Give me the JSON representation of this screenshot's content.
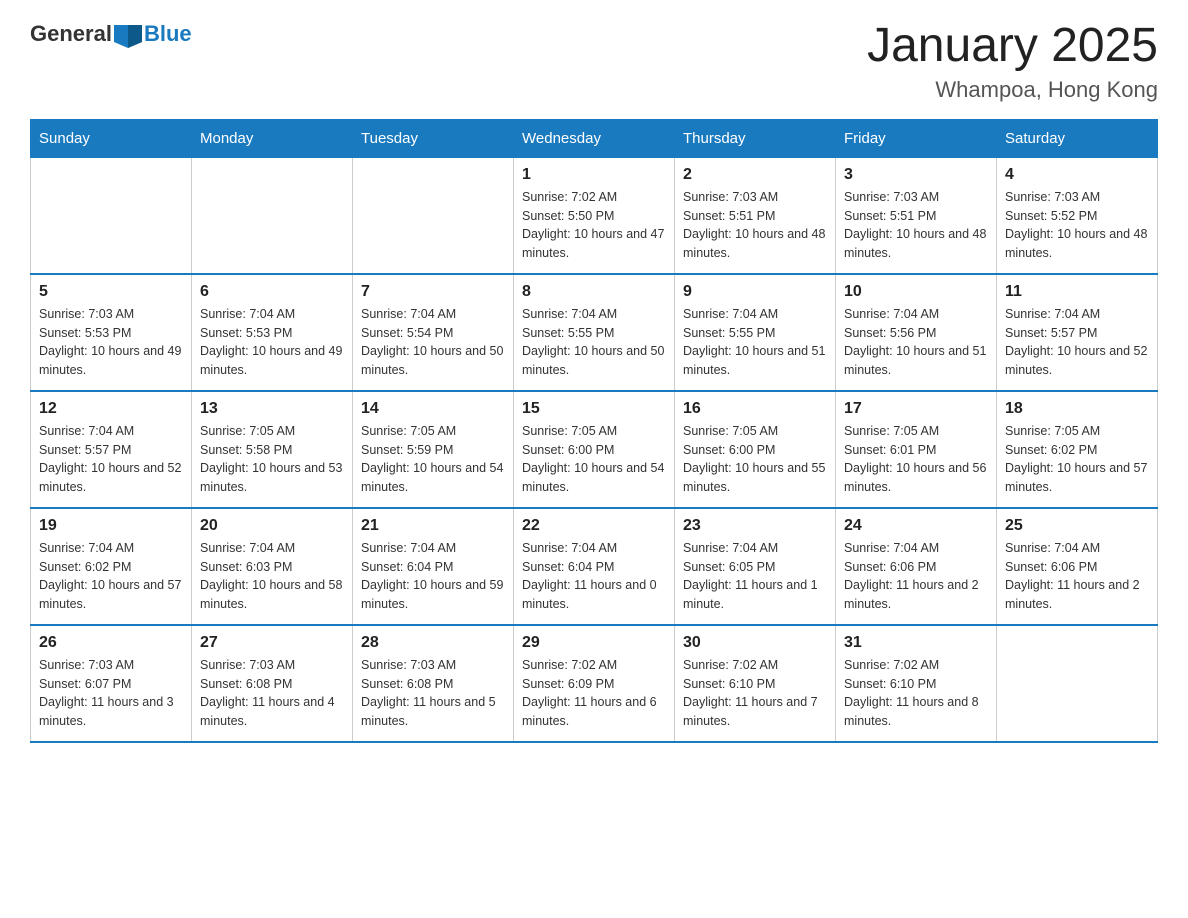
{
  "header": {
    "logo_general": "General",
    "logo_blue": "Blue",
    "month_year": "January 2025",
    "location": "Whampoa, Hong Kong"
  },
  "weekdays": [
    "Sunday",
    "Monday",
    "Tuesday",
    "Wednesday",
    "Thursday",
    "Friday",
    "Saturday"
  ],
  "weeks": [
    {
      "days": [
        {
          "number": "",
          "info": ""
        },
        {
          "number": "",
          "info": ""
        },
        {
          "number": "",
          "info": ""
        },
        {
          "number": "1",
          "info": "Sunrise: 7:02 AM\nSunset: 5:50 PM\nDaylight: 10 hours and 47 minutes."
        },
        {
          "number": "2",
          "info": "Sunrise: 7:03 AM\nSunset: 5:51 PM\nDaylight: 10 hours and 48 minutes."
        },
        {
          "number": "3",
          "info": "Sunrise: 7:03 AM\nSunset: 5:51 PM\nDaylight: 10 hours and 48 minutes."
        },
        {
          "number": "4",
          "info": "Sunrise: 7:03 AM\nSunset: 5:52 PM\nDaylight: 10 hours and 48 minutes."
        }
      ]
    },
    {
      "days": [
        {
          "number": "5",
          "info": "Sunrise: 7:03 AM\nSunset: 5:53 PM\nDaylight: 10 hours and 49 minutes."
        },
        {
          "number": "6",
          "info": "Sunrise: 7:04 AM\nSunset: 5:53 PM\nDaylight: 10 hours and 49 minutes."
        },
        {
          "number": "7",
          "info": "Sunrise: 7:04 AM\nSunset: 5:54 PM\nDaylight: 10 hours and 50 minutes."
        },
        {
          "number": "8",
          "info": "Sunrise: 7:04 AM\nSunset: 5:55 PM\nDaylight: 10 hours and 50 minutes."
        },
        {
          "number": "9",
          "info": "Sunrise: 7:04 AM\nSunset: 5:55 PM\nDaylight: 10 hours and 51 minutes."
        },
        {
          "number": "10",
          "info": "Sunrise: 7:04 AM\nSunset: 5:56 PM\nDaylight: 10 hours and 51 minutes."
        },
        {
          "number": "11",
          "info": "Sunrise: 7:04 AM\nSunset: 5:57 PM\nDaylight: 10 hours and 52 minutes."
        }
      ]
    },
    {
      "days": [
        {
          "number": "12",
          "info": "Sunrise: 7:04 AM\nSunset: 5:57 PM\nDaylight: 10 hours and 52 minutes."
        },
        {
          "number": "13",
          "info": "Sunrise: 7:05 AM\nSunset: 5:58 PM\nDaylight: 10 hours and 53 minutes."
        },
        {
          "number": "14",
          "info": "Sunrise: 7:05 AM\nSunset: 5:59 PM\nDaylight: 10 hours and 54 minutes."
        },
        {
          "number": "15",
          "info": "Sunrise: 7:05 AM\nSunset: 6:00 PM\nDaylight: 10 hours and 54 minutes."
        },
        {
          "number": "16",
          "info": "Sunrise: 7:05 AM\nSunset: 6:00 PM\nDaylight: 10 hours and 55 minutes."
        },
        {
          "number": "17",
          "info": "Sunrise: 7:05 AM\nSunset: 6:01 PM\nDaylight: 10 hours and 56 minutes."
        },
        {
          "number": "18",
          "info": "Sunrise: 7:05 AM\nSunset: 6:02 PM\nDaylight: 10 hours and 57 minutes."
        }
      ]
    },
    {
      "days": [
        {
          "number": "19",
          "info": "Sunrise: 7:04 AM\nSunset: 6:02 PM\nDaylight: 10 hours and 57 minutes."
        },
        {
          "number": "20",
          "info": "Sunrise: 7:04 AM\nSunset: 6:03 PM\nDaylight: 10 hours and 58 minutes."
        },
        {
          "number": "21",
          "info": "Sunrise: 7:04 AM\nSunset: 6:04 PM\nDaylight: 10 hours and 59 minutes."
        },
        {
          "number": "22",
          "info": "Sunrise: 7:04 AM\nSunset: 6:04 PM\nDaylight: 11 hours and 0 minutes."
        },
        {
          "number": "23",
          "info": "Sunrise: 7:04 AM\nSunset: 6:05 PM\nDaylight: 11 hours and 1 minute."
        },
        {
          "number": "24",
          "info": "Sunrise: 7:04 AM\nSunset: 6:06 PM\nDaylight: 11 hours and 2 minutes."
        },
        {
          "number": "25",
          "info": "Sunrise: 7:04 AM\nSunset: 6:06 PM\nDaylight: 11 hours and 2 minutes."
        }
      ]
    },
    {
      "days": [
        {
          "number": "26",
          "info": "Sunrise: 7:03 AM\nSunset: 6:07 PM\nDaylight: 11 hours and 3 minutes."
        },
        {
          "number": "27",
          "info": "Sunrise: 7:03 AM\nSunset: 6:08 PM\nDaylight: 11 hours and 4 minutes."
        },
        {
          "number": "28",
          "info": "Sunrise: 7:03 AM\nSunset: 6:08 PM\nDaylight: 11 hours and 5 minutes."
        },
        {
          "number": "29",
          "info": "Sunrise: 7:02 AM\nSunset: 6:09 PM\nDaylight: 11 hours and 6 minutes."
        },
        {
          "number": "30",
          "info": "Sunrise: 7:02 AM\nSunset: 6:10 PM\nDaylight: 11 hours and 7 minutes."
        },
        {
          "number": "31",
          "info": "Sunrise: 7:02 AM\nSunset: 6:10 PM\nDaylight: 11 hours and 8 minutes."
        },
        {
          "number": "",
          "info": ""
        }
      ]
    }
  ]
}
